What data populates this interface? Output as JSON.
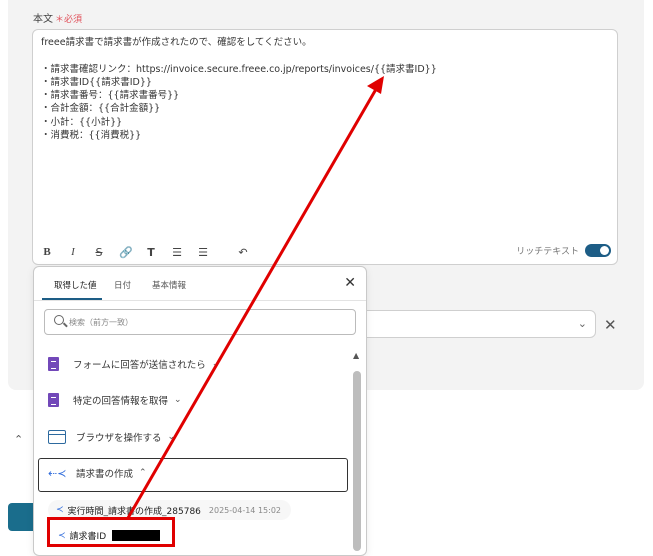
{
  "field": {
    "label": "本文",
    "required": "＊必須",
    "body_lines": [
      "freee請求書で請求書が作成されたので、確認をしてください。",
      "",
      "・請求書確認リンク：https://invoice.secure.freee.co.jp/reports/invoices/{{請求書ID}}",
      "・請求書ID{{請求書ID}}",
      "・請求書番号：{{請求書番号}}",
      "・合計金額：{{合計金額}}",
      "・小計：{{小計}}",
      "・消費税：{{消費税}}"
    ]
  },
  "toolbar": {
    "bold": "B",
    "italic": "I",
    "strike": "S",
    "link": "🔗",
    "heading": "T",
    "bullet_list": "☰",
    "ordered_list": "☰",
    "undo": "↶",
    "rich_text_label": "リッチテキスト",
    "rich_text_on": true
  },
  "popup": {
    "tabs": [
      "取得した値",
      "日付",
      "基本情報"
    ],
    "active_tab": "取得した値",
    "close": "✕",
    "search_placeholder": "検索（前方一致）",
    "items": [
      {
        "label": "フォームに回答が送信されたら",
        "icon": "google-forms-icon",
        "chevron": "⌄"
      },
      {
        "label": "特定の回答情報を取得",
        "icon": "google-forms-icon",
        "chevron": "⌄"
      },
      {
        "label": "ブラウザを操作する",
        "icon": "browser-icon",
        "chevron": "⌄"
      },
      {
        "label": "請求書の作成",
        "icon": "freee-icon",
        "chevron": "⌃"
      }
    ],
    "sub_item": {
      "label": "実行時間_請求書の作成_285786",
      "timestamp": "2025-04-14 15:02"
    },
    "value_item": {
      "label": "請求書ID"
    }
  },
  "select": {
    "chevron": "⌄",
    "clear": "✕"
  },
  "colors": {
    "accent": "#1d5d86",
    "highlight": "#e00000",
    "forms": "#7248b9"
  }
}
